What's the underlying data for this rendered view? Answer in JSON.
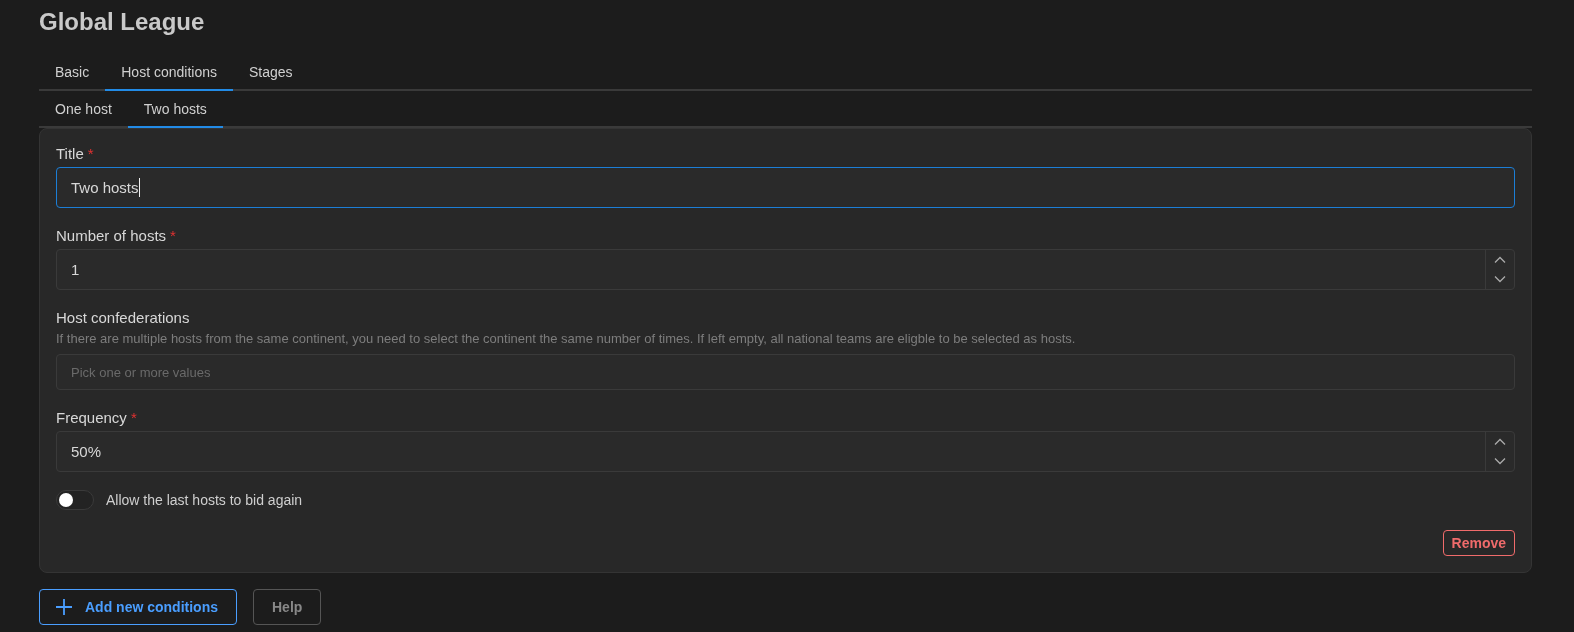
{
  "page": {
    "title": "Global League"
  },
  "tabs": [
    {
      "label": "Basic",
      "selected": false
    },
    {
      "label": "Host conditions",
      "selected": true
    },
    {
      "label": "Stages",
      "selected": false
    }
  ],
  "subtabs": [
    {
      "label": "One host",
      "selected": false
    },
    {
      "label": "Two hosts",
      "selected": true
    }
  ],
  "form": {
    "fields": [
      {
        "kind": "text",
        "label": "Title",
        "required_mark": "*",
        "value": "Two hosts",
        "focused": true
      },
      {
        "kind": "number",
        "label": "Number of hosts",
        "required_mark": "*",
        "value": "1",
        "focused": false
      },
      {
        "kind": "multiselect",
        "label": "Host confederations",
        "description": "If there are multiple hosts from the same continent, you need to select the continent the same number of times. If left empty, all national teams are eligble to be selected as hosts.",
        "placeholder": "Pick one or more values",
        "focused": false
      },
      {
        "kind": "number",
        "label": "Frequency",
        "required_mark": "*",
        "value": "50%",
        "focused": false
      }
    ],
    "toggle": {
      "label": "Allow the last hosts to bid again",
      "on": false
    },
    "remove_button": "Remove"
  },
  "buttons": [
    {
      "label": "Add new conditions",
      "kind": "primary"
    },
    {
      "label": "Help",
      "kind": "secondary"
    }
  ]
}
